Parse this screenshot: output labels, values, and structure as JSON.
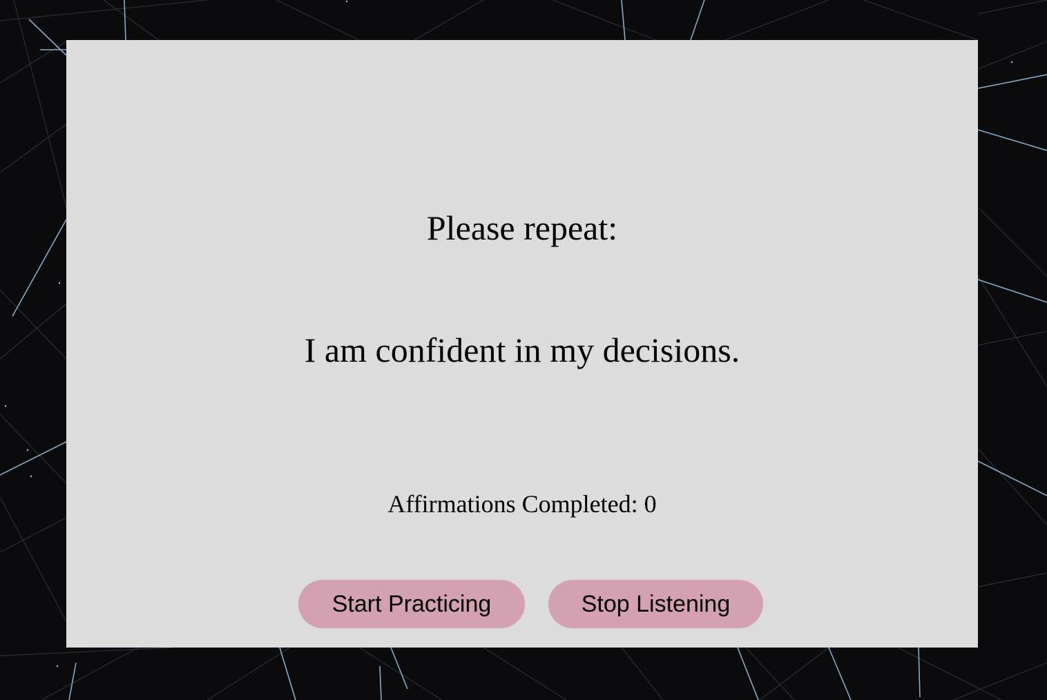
{
  "prompt": {
    "heading": "Please repeat:"
  },
  "affirmation": {
    "text": "I am confident in my decisions."
  },
  "counter": {
    "label": "Affirmations Completed: 0"
  },
  "buttons": {
    "start_label": "Start Practicing",
    "stop_label": "Stop Listening"
  },
  "colors": {
    "background": "#0b0b0d",
    "background_lines": "#3a4450",
    "background_highlight_lines": "#9ec8ea",
    "panel": "#dcdcdc",
    "button": "#d3a1b2",
    "text": "#000000"
  }
}
